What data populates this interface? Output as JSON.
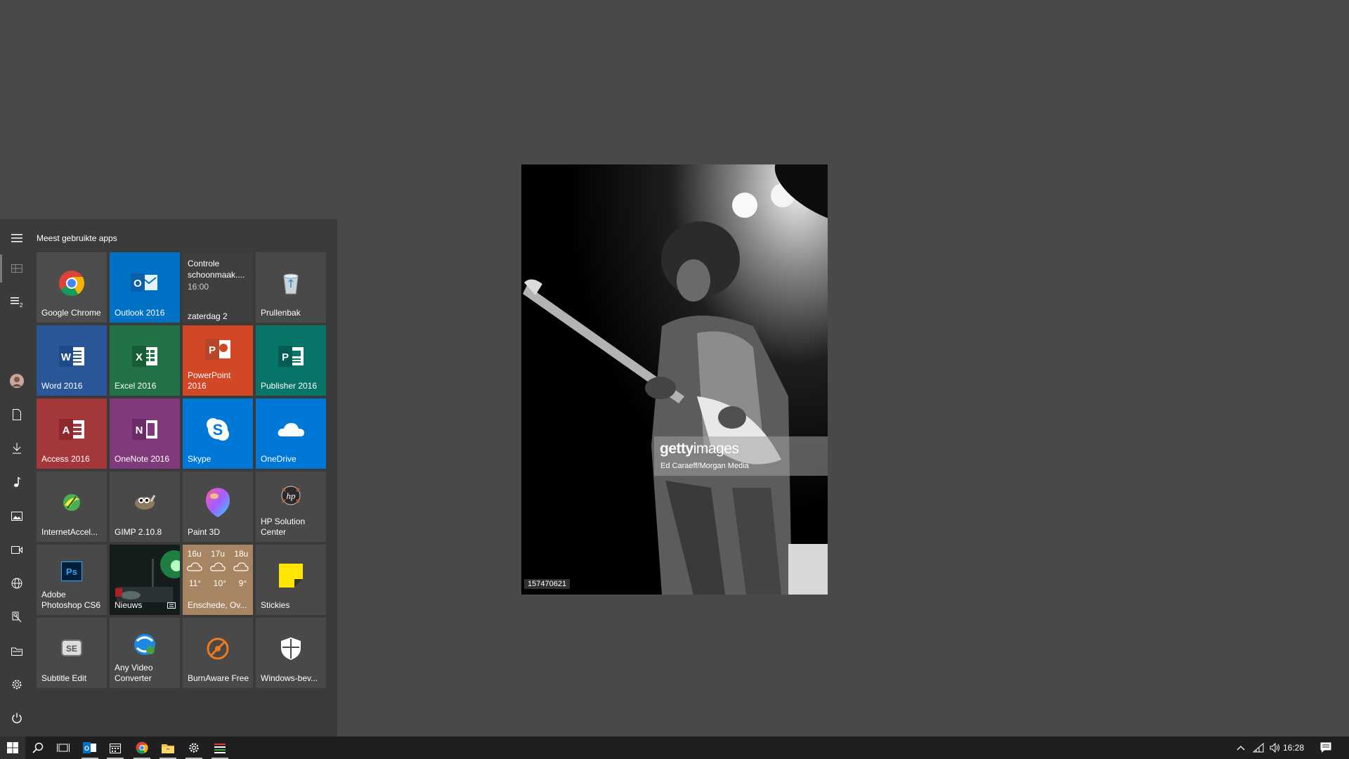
{
  "photo": {
    "watermark_brand_bold": "getty",
    "watermark_brand_rest": "images",
    "credit": "Ed Caraeff/Morgan Media",
    "image_id": "157470621"
  },
  "start_menu": {
    "title": "Meest gebruikte apps",
    "rail_icons": [
      "hamburger-menu-icon",
      "tiles-view-icon",
      "app-list-icon",
      "user-avatar",
      "documents-icon",
      "downloads-icon",
      "music-icon",
      "pictures-icon",
      "videos-icon",
      "network-icon",
      "personal-folder-icon",
      "file-explorer-icon",
      "settings-icon",
      "power-icon"
    ],
    "tiles": {
      "chrome": {
        "label": "Google Chrome",
        "color": "#4d4d4d"
      },
      "outlook": {
        "label": "Outlook 2016",
        "color": "#0072c6"
      },
      "calendar": {
        "event": "Controle schoonmaak....",
        "time": "16:00",
        "date": "zaterdag 2",
        "color": "#3f3f3f"
      },
      "recycle": {
        "label": "Prullenbak",
        "color": "#494949"
      },
      "word": {
        "label": "Word 2016",
        "color": "#2b579a"
      },
      "excel": {
        "label": "Excel 2016",
        "color": "#217346"
      },
      "powerpoint": {
        "label": "PowerPoint 2016",
        "color": "#d24726"
      },
      "publisher": {
        "label": "Publisher 2016",
        "color": "#077568"
      },
      "access": {
        "label": "Access 2016",
        "color": "#a4373a"
      },
      "onenote": {
        "label": "OneNote 2016",
        "color": "#80397b"
      },
      "skype": {
        "label": "Skype",
        "color": "#0078d7"
      },
      "onedrive": {
        "label": "OneDrive",
        "color": "#0078d7"
      },
      "internetaccel": {
        "label": "InternetAccel...",
        "color": "#494949"
      },
      "gimp": {
        "label": "GIMP 2.10.8",
        "color": "#494949"
      },
      "paint3d": {
        "label": "Paint 3D",
        "color": "#494949"
      },
      "hpsolution": {
        "label": "HP Solution Center",
        "color": "#494949"
      },
      "photoshop": {
        "label": "Adobe Photoshop CS6",
        "color": "#494949"
      },
      "nieuws": {
        "label": "Nieuws",
        "color": "#1b2a2a"
      },
      "weather": {
        "label": "Enschede, Ov...",
        "color": "#a78563",
        "days": [
          {
            "hour": "16u",
            "temp": "11°"
          },
          {
            "hour": "17u",
            "temp": "10°"
          },
          {
            "hour": "18u",
            "temp": "9°"
          }
        ]
      },
      "stickies": {
        "label": "Stickies",
        "color": "#494949"
      },
      "subtitleedit": {
        "label": "Subtitle Edit",
        "color": "#494949"
      },
      "anyvideo": {
        "label": "Any Video Converter",
        "color": "#494949"
      },
      "burnaware": {
        "label": "BurnAware Free",
        "color": "#494949"
      },
      "defender": {
        "label": "Windows-bev...",
        "color": "#494949"
      }
    }
  },
  "taskbar": {
    "clock": "16:28",
    "items": [
      "start-button",
      "search-icon",
      "task-view-icon",
      "outlook-taskbar-icon",
      "calendar-taskbar-icon",
      "chrome-taskbar-icon",
      "file-explorer-taskbar-icon",
      "settings-taskbar-icon",
      "app-taskbar-icon"
    ],
    "tray": [
      "show-hidden-icons-chevron",
      "network-icon",
      "volume-icon",
      "notifications-icon"
    ]
  }
}
